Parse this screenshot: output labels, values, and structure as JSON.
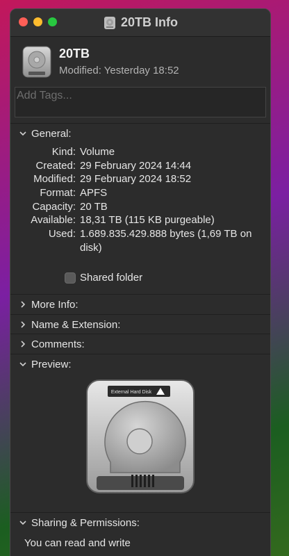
{
  "window": {
    "title": "20TB Info",
    "icon": "hard-drive-icon"
  },
  "header": {
    "name": "20TB",
    "modified": "Modified: Yesterday 18:52"
  },
  "tags": {
    "placeholder": "Add Tags..."
  },
  "sections": {
    "general": "General:",
    "more_info": "More Info:",
    "name_extension": "Name & Extension:",
    "comments": "Comments:",
    "preview": "Preview:",
    "sharing": "Sharing & Permissions:"
  },
  "general": {
    "rows": [
      {
        "k": "Kind:",
        "v": "Volume"
      },
      {
        "k": "Created:",
        "v": "29 February 2024 14:44"
      },
      {
        "k": "Modified:",
        "v": "29 February 2024 18:52"
      },
      {
        "k": "Format:",
        "v": "APFS"
      },
      {
        "k": "Capacity:",
        "v": "20 TB"
      },
      {
        "k": "Available:",
        "v": "18,31 TB (115 KB purgeable)"
      },
      {
        "k": "Used:",
        "v": "1.689.835.429.888 bytes (1,69 TB on disk)"
      }
    ],
    "shared_folder": "Shared folder"
  },
  "preview": {
    "drive_label": "External Hard Disk"
  },
  "permissions": {
    "text": "You can read and write"
  }
}
